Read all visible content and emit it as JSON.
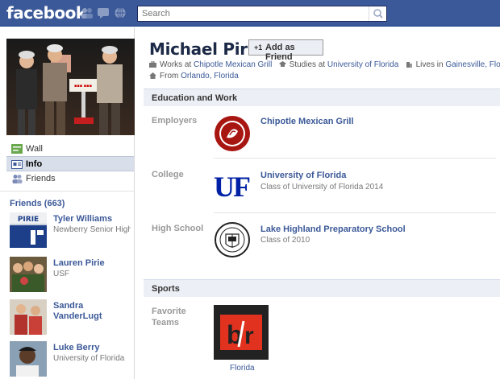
{
  "topbar": {
    "logo": "facebook",
    "search_placeholder": "Search",
    "jewels": [
      "friend-requests-icon",
      "messages-icon",
      "notifications-icon"
    ]
  },
  "nav": {
    "items": [
      {
        "label": "Wall",
        "icon": "wall-icon"
      },
      {
        "label": "Info",
        "icon": "info-icon"
      },
      {
        "label": "Friends",
        "icon": "friends-icon"
      }
    ]
  },
  "friends": {
    "heading": "Friends (663)",
    "list": [
      {
        "name": "Tyler Williams",
        "sub": "Newberry Senior High"
      },
      {
        "name": "Lauren Pirie",
        "sub": "USF"
      },
      {
        "name": "Sandra VanderLugt",
        "sub": ""
      },
      {
        "name": "Luke Berry",
        "sub": "University of Florida"
      }
    ]
  },
  "profile": {
    "name": "Michael Pirie",
    "add_friend_label": "Add as Friend",
    "works_prefix": "Works at ",
    "works_at": "Chipotle Mexican Grill",
    "studies_prefix": "Studies at ",
    "studies_at": "University of Florida",
    "lives_prefix": "Lives in ",
    "lives_in": "Gainesville, Florida",
    "from_prefix": "From ",
    "from": "Orlando, Florida"
  },
  "education": {
    "heading": "Education and Work",
    "employers_label": "Employers",
    "employer": "Chipotle Mexican Grill",
    "college_label": "College",
    "college": "University of Florida",
    "college_sub": "Class of University of Florida 2014",
    "highschool_label": "High School",
    "highschool": "Lake Highland Preparatory School",
    "highschool_sub": "Class of 2010"
  },
  "sports": {
    "heading": "Sports",
    "favorite_label": "Favorite Teams",
    "team": "Florida"
  },
  "colors": {
    "brand": "#3b5998",
    "uf_blue": "#0021a5",
    "chipotle_red": "#a81612",
    "br_red": "#e0321f"
  }
}
